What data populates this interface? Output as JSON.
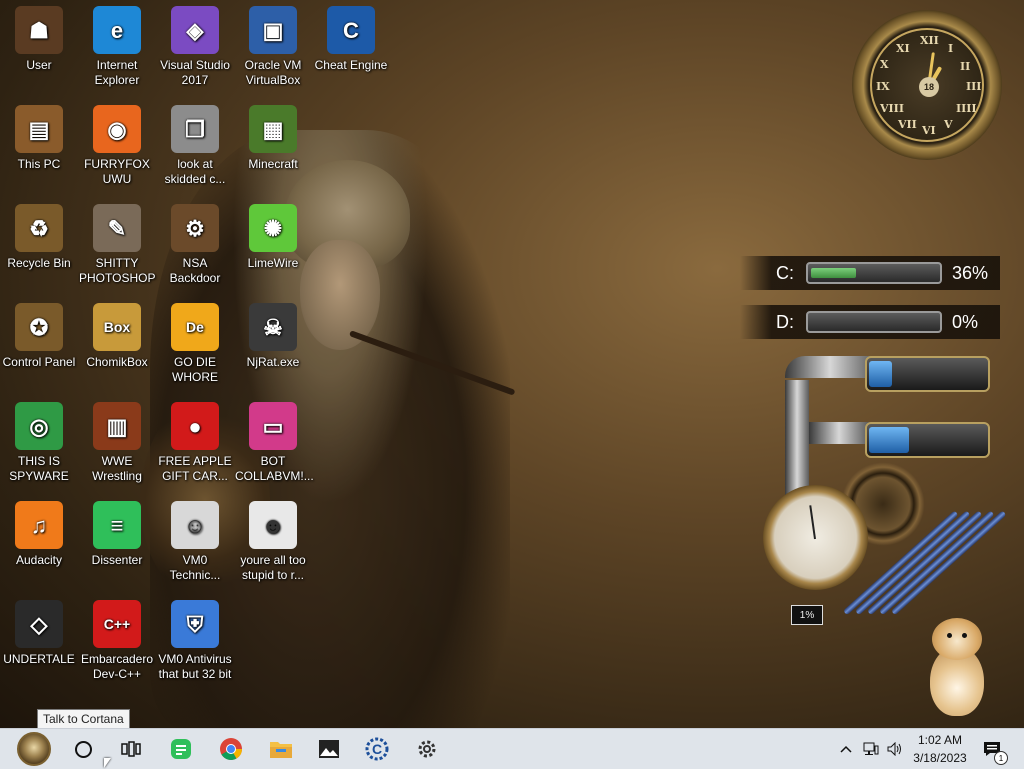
{
  "desktop_icons": [
    {
      "label": "User",
      "icon": "user-folder-icon",
      "color": "#5a3b22"
    },
    {
      "label": "Internet Explorer",
      "icon": "edge-icon",
      "color": "#1e88d6"
    },
    {
      "label": "Visual Studio 2017",
      "icon": "visual-studio-icon",
      "color": "#7b4bc2"
    },
    {
      "label": "Oracle VM VirtualBox",
      "icon": "virtualbox-icon",
      "color": "#2d5fa8"
    },
    {
      "label": "Cheat Engine",
      "icon": "cheat-engine-icon",
      "color": "#1d5aa8"
    },
    {
      "label": "This PC",
      "icon": "computer-icon",
      "color": "#8a5b2b"
    },
    {
      "label": "FURRYFOX UWU",
      "icon": "firefox-icon",
      "color": "#e8661e"
    },
    {
      "label": "look at skidded c...",
      "icon": "shortcut-icon",
      "color": "#8c8c8c"
    },
    {
      "label": "Minecraft",
      "icon": "minecraft-icon",
      "color": "#4a7a2a"
    },
    {
      "label": "Recycle Bin",
      "icon": "recycle-bin-icon",
      "color": "#7a5a2a"
    },
    {
      "label": "SHITTY PHOTOSHOP",
      "icon": "gimp-icon",
      "color": "#7a6a58"
    },
    {
      "label": "NSA Backdoor",
      "icon": "backdoor-icon",
      "color": "#6b4a2a"
    },
    {
      "label": "LimeWire",
      "icon": "limewire-icon",
      "color": "#5fc83a"
    },
    {
      "label": "Control Panel",
      "icon": "control-panel-icon",
      "color": "#7a5a2a"
    },
    {
      "label": "ChomikBox",
      "icon": "chomikbox-icon",
      "color": "#c89a3a"
    },
    {
      "label": "GO DIE WHORE",
      "icon": "de-icon",
      "color": "#f0a81a"
    },
    {
      "label": "NjRat.exe",
      "icon": "skull-icon",
      "color": "#3a3a3a"
    },
    {
      "label": "THIS IS SPYWARE",
      "icon": "chrome-icon",
      "color": "#2f9a45"
    },
    {
      "label": "WWE Wrestling",
      "icon": "wwe-icon",
      "color": "#8a3a1a"
    },
    {
      "label": "FREE APPLE GIFT CAR...",
      "icon": "apple-icon",
      "color": "#d21a1a"
    },
    {
      "label": "BOT COLLABVM!...",
      "icon": "collabvm-icon",
      "color": "#d23a8a"
    },
    {
      "label": "Audacity",
      "icon": "audacity-icon",
      "color": "#f07a1a"
    },
    {
      "label": "Dissenter",
      "icon": "dissenter-icon",
      "color": "#2fbf5a"
    },
    {
      "label": "VM0 Technic...",
      "icon": "technician-icon",
      "color": "#d8d8d8"
    },
    {
      "label": "youre all too stupid to r...",
      "icon": "portrait-icon",
      "color": "#e8e8e8"
    },
    {
      "label": "UNDERTALE",
      "icon": "unity-icon",
      "color": "#2a2a2a"
    },
    {
      "label": "Embarcadero Dev-C++",
      "icon": "devcpp-icon",
      "color": "#d21a1a"
    },
    {
      "label": "VM0 Antivirus that but 32 bit",
      "icon": "shield-icon",
      "color": "#3a7ad8"
    }
  ],
  "widgets": {
    "clock": {
      "date": "18",
      "numerals": [
        "XII",
        "I",
        "II",
        "III",
        "IIII",
        "V",
        "VI",
        "VII",
        "VIII",
        "IX",
        "X",
        "XI"
      ]
    },
    "drives": [
      {
        "letter": "C:",
        "percent_text": "36%",
        "fill": 0.36
      },
      {
        "letter": "D:",
        "percent_text": "0%",
        "fill": 0.0
      }
    ],
    "tanks": [
      {
        "fill": 0.2
      },
      {
        "fill": 0.35
      }
    ],
    "gauge_percent": "1%"
  },
  "tooltip": "Talk to Cortana",
  "taskbar": {
    "apps": [
      "start-orb",
      "cortana",
      "task-view",
      "dissenter",
      "chrome",
      "file-explorer",
      "photos",
      "cheat-engine",
      "settings"
    ],
    "time": "1:02 AM",
    "date": "3/18/2023",
    "notification_count": "1"
  }
}
